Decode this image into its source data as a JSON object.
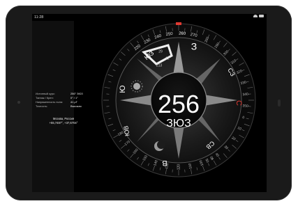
{
  "status_bar": {
    "time": "11:28"
  },
  "info_panel": {
    "rows": [
      {
        "label": "Истинный курс:",
        "value": "256° ЗЮЗ"
      },
      {
        "label": "Тангаж / Крен:",
        "value": "0° / 1°"
      },
      {
        "label": "Напряженность поля:",
        "value": "41 μT"
      },
      {
        "label": "Точность:",
        "value": "Высокая"
      }
    ],
    "location": "Москва, Россия",
    "coordinates": "+55,7487°, +37,6704°"
  },
  "compass": {
    "heading": "256",
    "direction": "ЗЮЗ",
    "bearing_ticks": [
      "220",
      "230",
      "240",
      "250",
      "260",
      "270"
    ],
    "left_ticks": [
      "180",
      "170",
      "160",
      "150",
      "140",
      "130",
      "120",
      "110",
      "100",
      "90"
    ],
    "right_ticks": [
      "280",
      "290",
      "300",
      "310",
      "320",
      "330",
      "340",
      "350",
      "0",
      "10",
      "20",
      "30",
      "40",
      "50"
    ],
    "cardinals": {
      "top": "З",
      "upper_left": "ЮЗ",
      "upper_right": "СЗ",
      "right": "С",
      "lower_right": "СВ",
      "bottom": "В",
      "lower_left": "ЮВ",
      "left": "Ю"
    },
    "small_marks": [
      "213",
      "12",
      "29"
    ]
  },
  "colors": {
    "accent_red": "#e03a32",
    "background": "#000000",
    "ring": "#2a2a2a"
  }
}
